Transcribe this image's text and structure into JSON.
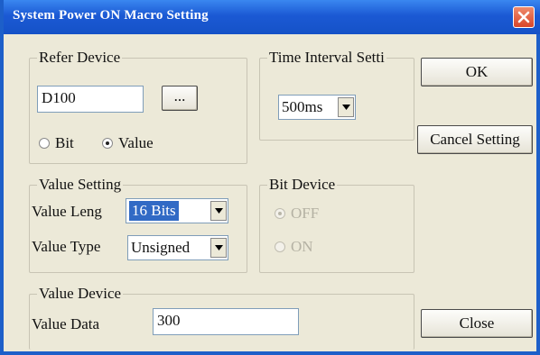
{
  "window": {
    "title": "System Power ON Macro Setting"
  },
  "refer_device": {
    "label": "Refer Device",
    "device_value": "D100",
    "browse_label": "...",
    "radio_bit": "Bit",
    "radio_value": "Value",
    "selected": "Value"
  },
  "time_interval": {
    "label": "Time Interval Setti",
    "selected": "500ms"
  },
  "buttons": {
    "ok": "OK",
    "cancel": "Cancel Setting",
    "close": "Close"
  },
  "value_setting": {
    "label": "Value Setting",
    "length_label": "Value Leng",
    "length_value": "16 Bits",
    "type_label": "Value Type",
    "type_value": "Unsigned"
  },
  "bit_device": {
    "label": "Bit Device",
    "off": "OFF",
    "on": "ON",
    "selected": "OFF",
    "enabled": false
  },
  "value_device": {
    "label": "Value Device",
    "data_label": "Value Data",
    "data_value": "300"
  },
  "colors": {
    "titlebar": "#1b59d4",
    "close_button": "#d8452a",
    "selection": "#316ac5",
    "dialog_bg": "#ece9d8"
  },
  "icons": {
    "close": "close-x-icon",
    "dropdown": "chevron-down-icon"
  }
}
